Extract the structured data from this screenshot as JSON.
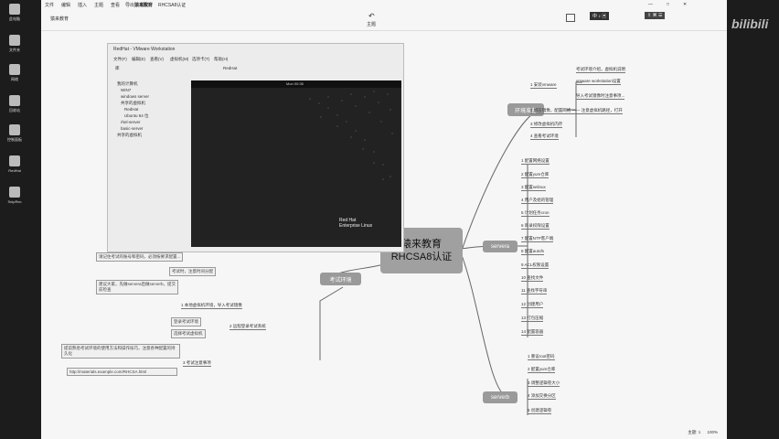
{
  "desktop": {
    "icons": [
      {
        "label": "此电脑",
        "icon": "computer-icon"
      },
      {
        "label": "文件夹",
        "icon": "folder-icon"
      },
      {
        "label": "网络",
        "icon": "network-icon"
      },
      {
        "label": "回收站",
        "icon": "trash-icon"
      },
      {
        "label": "控制面板",
        "icon": "control-icon"
      },
      {
        "label": "RedHat",
        "icon": "redhat-icon"
      },
      {
        "label": "SnipRec",
        "icon": "recorder-icon"
      }
    ],
    "watermark": "bilibili"
  },
  "app": {
    "menu": [
      "文件",
      "编辑",
      "插入",
      "主题",
      "查看",
      "导出",
      "帮助",
      "猿来教育",
      "RHCSA8认证"
    ],
    "doc_tab": "猿来教育",
    "toolbar_center": "主题",
    "window_buttons": [
      "—",
      "□",
      "✕"
    ]
  },
  "mindmap": {
    "central": {
      "line1": "猿来教育",
      "line2": "RHCSA8认证"
    },
    "topics": {
      "env": "环境准备",
      "exam": "考试环境",
      "servera": "servera",
      "serverb": "serverb"
    },
    "env_items": [
      "1 安装vmware",
      "2 解压镜像，配置网络 —— 注意虚拟机路径，打开",
      "3 修改虚拟机内存",
      "4 查看考试环境"
    ],
    "env_subitems": [
      "考试环境介绍，虚拟机说明",
      "vmware workstation设置",
      "导入考试镜像时注意事项..."
    ],
    "servera_items": [
      "1 配置网络设置",
      "2 配置yum仓库",
      "3 配置selinux",
      "4 用户及组的管理",
      "5 计划任务cron",
      "6 目录权限设置",
      "7 配置NTP客户端",
      "8 配置autofs",
      "9 ACL权限设置",
      "10 查找文件",
      "11 查找字符串",
      "12 创建用户",
      "13 打包压缩",
      "14 配置容器"
    ],
    "serverb_items": [
      "1 重设root密码",
      "2 配置yum仓库",
      "3 调整逻辑卷大小",
      "4 添加交换分区",
      "5 创建逻辑卷"
    ],
    "exam_items": [
      "1 本地虚拟机环境，导入考试镜像",
      "2 远程登录考试系统",
      "3 考试注意事项"
    ],
    "exam_notes": [
      "请记住考试的账号和密码，必须按要求配置...",
      "考试时，注意时间分配",
      "建议大家，先做servera后做serverb，提交前检查",
      "登录考试环境",
      "选择考试虚拟机",
      "提前熟悉考试环境的使用方法和操作技巧，注意各种配置的持久化",
      "http://materials.example.com/RHCSA.html"
    ],
    "exam_top_note": "考试时大家可以在任意位置，考生需要遵守考场规则 Ctrl+A"
  },
  "vm": {
    "title": "RedHat - VMware Workstation",
    "menu": [
      "文件(F)",
      "编辑(E)",
      "查看(V)",
      "虚拟机(M)",
      "选项卡(T)",
      "帮助(H)"
    ],
    "tab": "RedHat",
    "library_title": "库",
    "tree": [
      "我的计算机",
      "WIN7",
      "windows server",
      "共享的虚拟机",
      "RedHat",
      "Ubuntu 64 位",
      "rhel-server",
      "basic-server",
      "共享的虚拟机"
    ],
    "clock": "Mon 00:35",
    "brand_line1": "Red Hat",
    "brand_line2": "Enterprise Linux"
  },
  "status": {
    "left": "主题: 1",
    "right": "100%"
  }
}
